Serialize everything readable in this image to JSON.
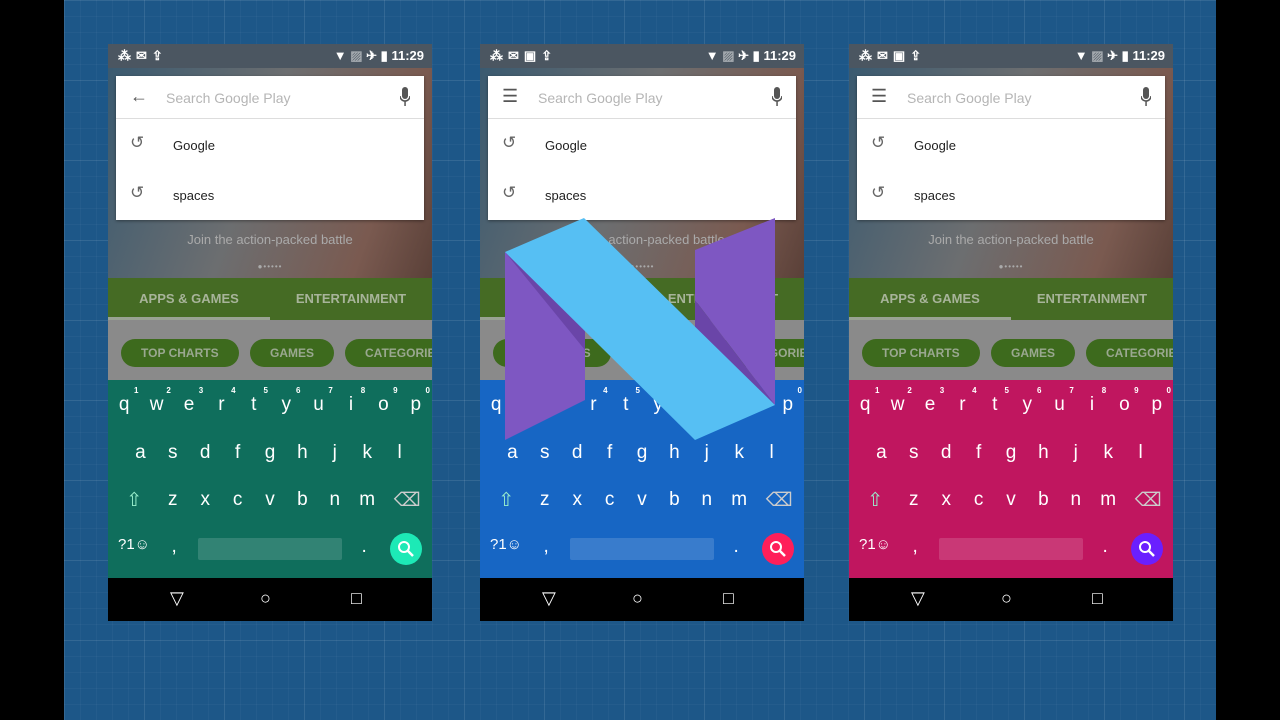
{
  "status": {
    "time": "11:29"
  },
  "search": {
    "placeholder": "Search Google Play",
    "history": [
      "Google",
      "spaces"
    ]
  },
  "banner": {
    "subtitle": "Join the action-packed battle",
    "dots": "●•••••"
  },
  "tabs": [
    "APPS & GAMES",
    "ENTERTAINMENT"
  ],
  "chips": [
    "TOP CHARTS",
    "GAMES",
    "CATEGORIES"
  ],
  "keyboard": {
    "row1": [
      "q",
      "w",
      "e",
      "r",
      "t",
      "y",
      "u",
      "i",
      "o",
      "p"
    ],
    "row1_hints": [
      "1",
      "2",
      "3",
      "4",
      "5",
      "6",
      "7",
      "8",
      "9",
      "0"
    ],
    "row2": [
      "a",
      "s",
      "d",
      "f",
      "g",
      "h",
      "j",
      "k",
      "l"
    ],
    "row3": [
      "z",
      "x",
      "c",
      "v",
      "b",
      "n",
      "m"
    ],
    "symbols": "?1☺",
    "comma": ",",
    "period": "."
  },
  "phones": [
    {
      "leading_icon": "arrow-back-icon",
      "keyboard_color": "#0f6e5c",
      "action_color": "#1de9b6",
      "status_icons": [
        "network-icon",
        "mail-icon",
        "upload-icon"
      ]
    },
    {
      "leading_icon": "menu-icon",
      "keyboard_color": "#1766c4",
      "action_color": "#ff1f5a",
      "status_icons": [
        "network-icon",
        "mail-icon",
        "image-icon",
        "upload-icon"
      ]
    },
    {
      "leading_icon": "menu-icon",
      "keyboard_color": "#c0165f",
      "action_color": "#6a1fff",
      "status_icons": [
        "network-icon",
        "mail-icon",
        "image-icon",
        "upload-icon"
      ]
    }
  ],
  "logo": {
    "colors": {
      "purple": "#7e57c2",
      "blue": "#56bff3",
      "shadow": "#6a45a8"
    }
  }
}
